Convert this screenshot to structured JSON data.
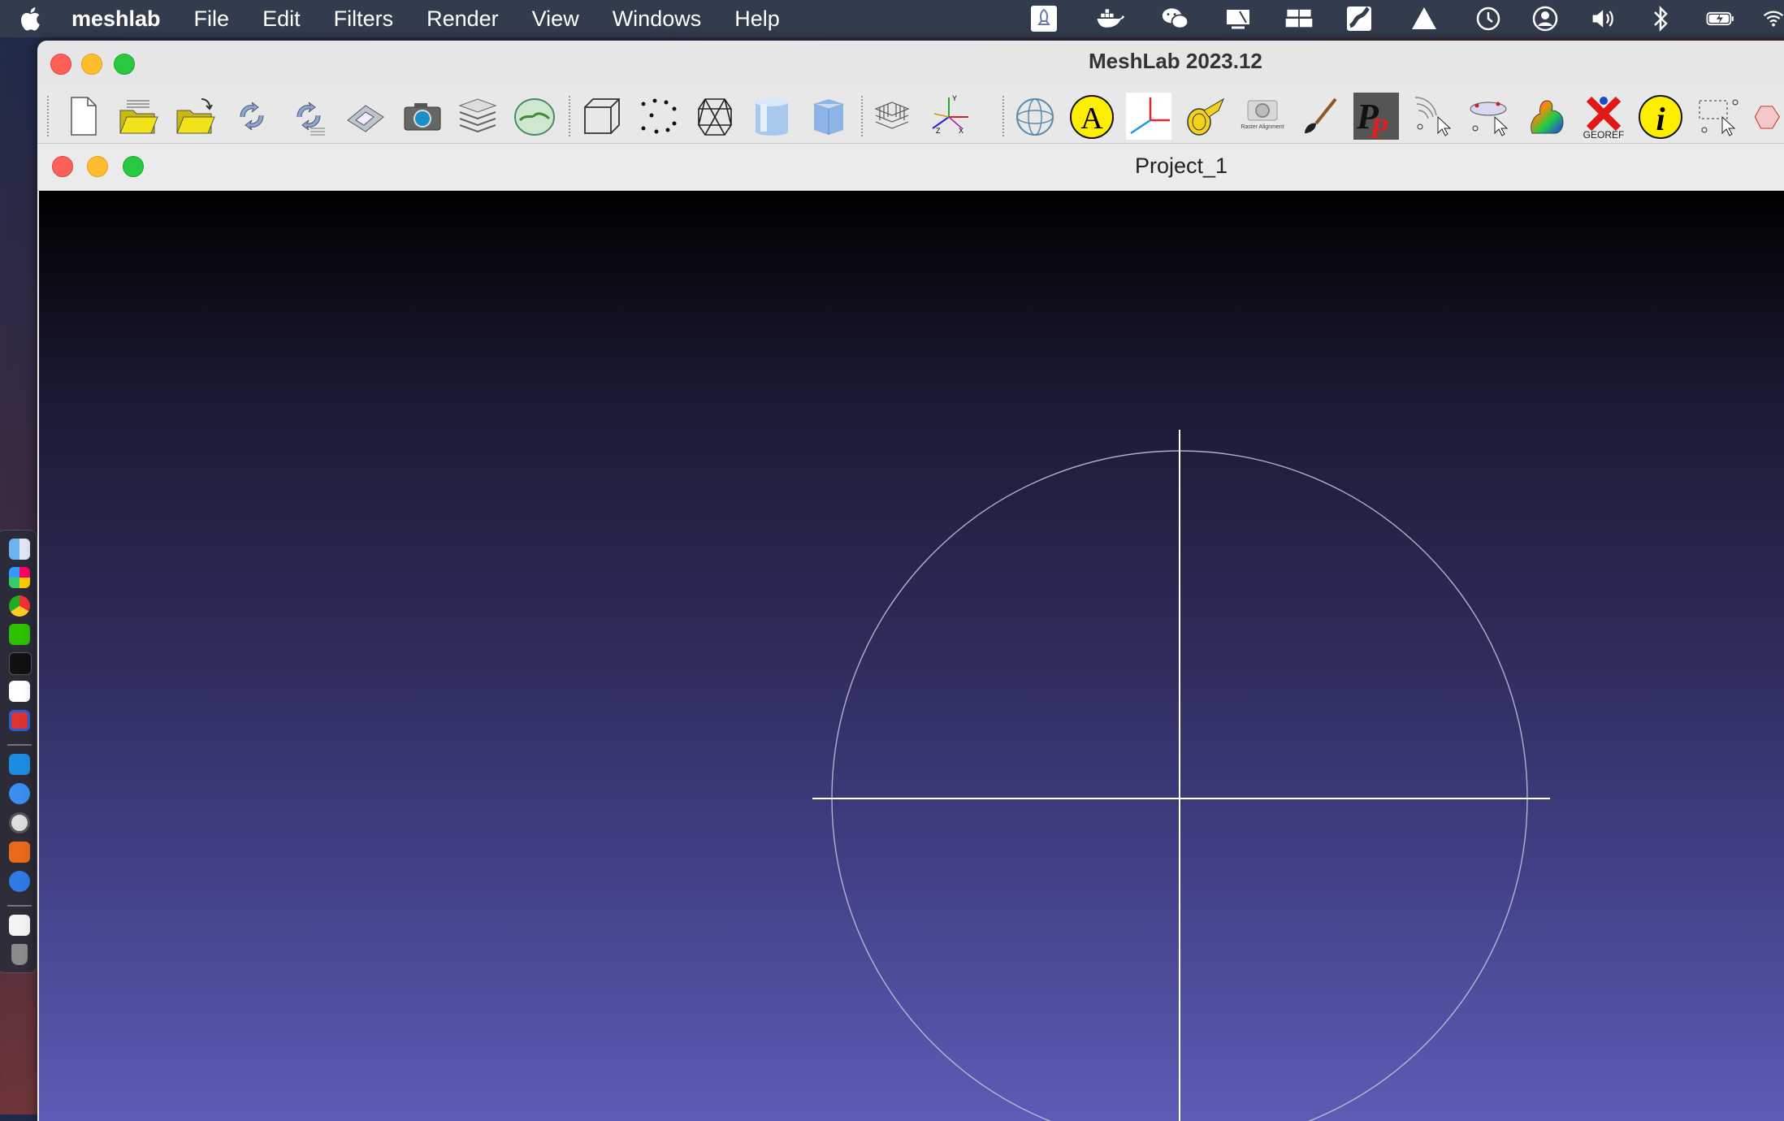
{
  "menubar": {
    "app_name": "meshlab",
    "items": [
      "File",
      "Edit",
      "Filters",
      "Render",
      "View",
      "Windows",
      "Help"
    ],
    "status_icons": [
      "rocket-icon",
      "docker-icon",
      "wechat-icon",
      "display-icon",
      "network-icon",
      "sync-icon",
      "drive-icon",
      "time-machine-icon",
      "user-icon",
      "volume-icon",
      "bluetooth-icon",
      "battery-icon",
      "wifi-icon"
    ]
  },
  "window": {
    "title": "MeshLab 2023.12"
  },
  "toolbar": {
    "buttons": [
      "new-project",
      "open-project",
      "import-mesh",
      "reload",
      "reload-all",
      "save-project",
      "snapshot",
      "layers",
      "raster",
      "bounding-box",
      "points",
      "wireframe",
      "flat",
      "smooth",
      "grid",
      "axes",
      "trackball",
      "annotation",
      "align",
      "measure",
      "raster-alignment",
      "paint",
      "pick-points",
      "select-points",
      "select-mesh",
      "quality-color",
      "georef",
      "info",
      "select-faces",
      "select-vertices"
    ],
    "raster_alignment_label": "Raster Alignment",
    "georef_label": "GEOREF",
    "annotation_letter": "A",
    "info_letter": "i",
    "pickpoints_letters": "P",
    "axes_labels": {
      "y": "Y",
      "z": "Z",
      "x": "X"
    }
  },
  "document": {
    "title": "Project_1"
  },
  "colors": {
    "menubar_bg": "#333c4d",
    "window_bg": "#ececec",
    "viewport_top": "#000000",
    "viewport_bottom": "#5c5cb5",
    "trackball": "#c8c8e0"
  }
}
